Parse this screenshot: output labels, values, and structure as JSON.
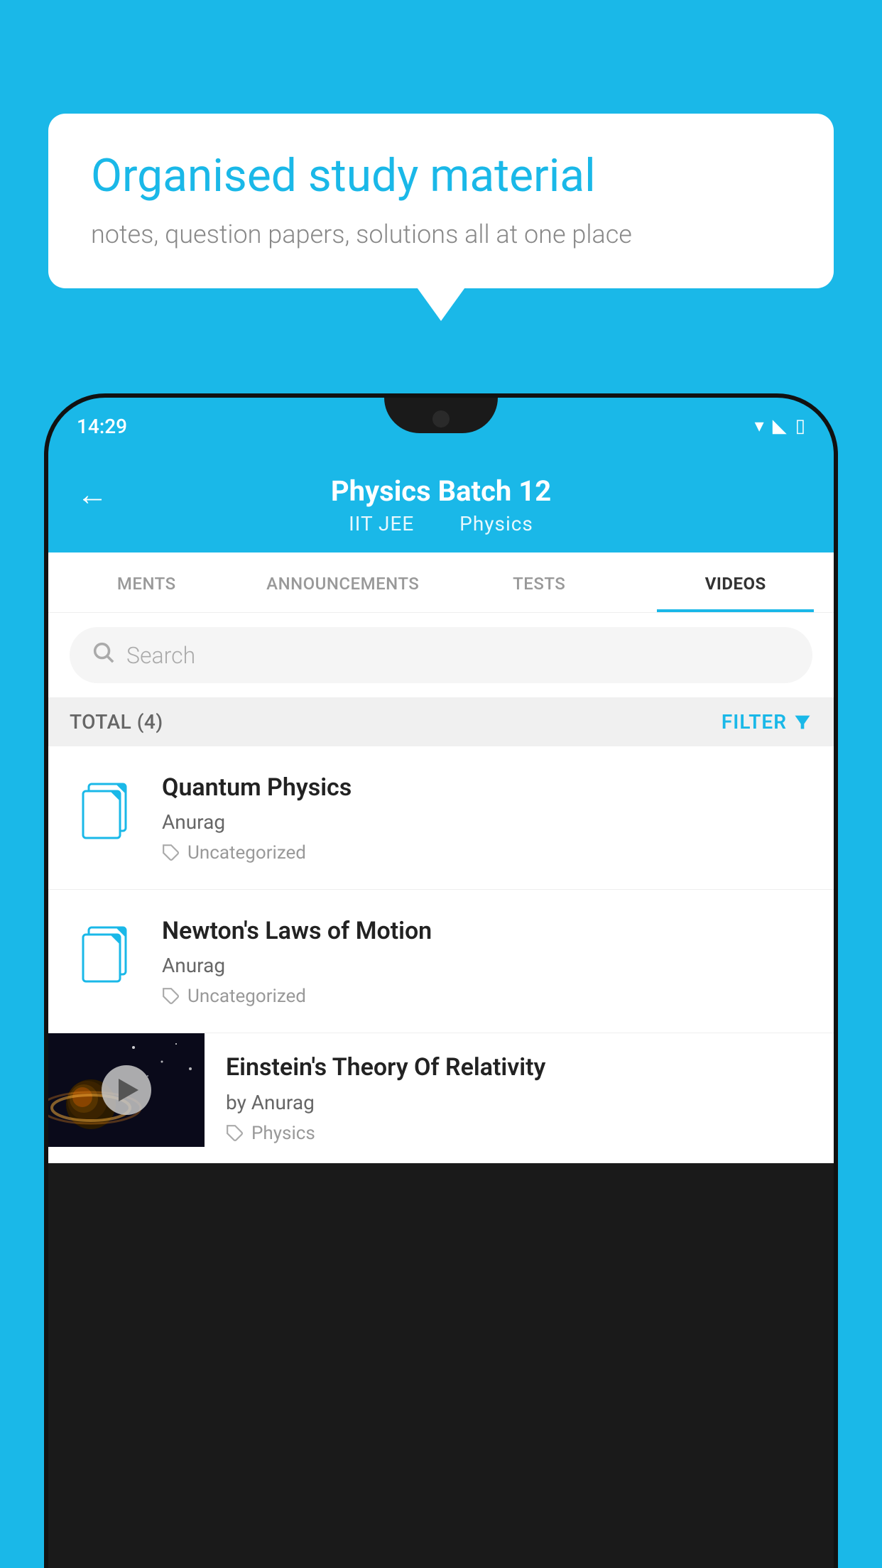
{
  "background": {
    "color": "#1ab8e8"
  },
  "speech_bubble": {
    "title": "Organised study material",
    "subtitle": "notes, question papers, solutions all at one place"
  },
  "status_bar": {
    "time": "14:29",
    "wifi": "▾",
    "signal": "◣",
    "battery": "▯"
  },
  "app_header": {
    "back_label": "←",
    "title": "Physics Batch 12",
    "subtitle_part1": "IIT JEE",
    "subtitle_part2": "Physics"
  },
  "tabs": [
    {
      "label": "MENTS",
      "active": false
    },
    {
      "label": "ANNOUNCEMENTS",
      "active": false
    },
    {
      "label": "TESTS",
      "active": false
    },
    {
      "label": "VIDEOS",
      "active": true
    }
  ],
  "search": {
    "placeholder": "Search"
  },
  "filter_bar": {
    "total_label": "TOTAL (4)",
    "filter_label": "FILTER"
  },
  "video_items": [
    {
      "title": "Quantum Physics",
      "author": "Anurag",
      "tag": "Uncategorized",
      "has_thumbnail": false
    },
    {
      "title": "Newton's Laws of Motion",
      "author": "Anurag",
      "tag": "Uncategorized",
      "has_thumbnail": false
    },
    {
      "title": "Einstein's Theory Of Relativity",
      "author": "by Anurag",
      "tag": "Physics",
      "has_thumbnail": true
    }
  ]
}
